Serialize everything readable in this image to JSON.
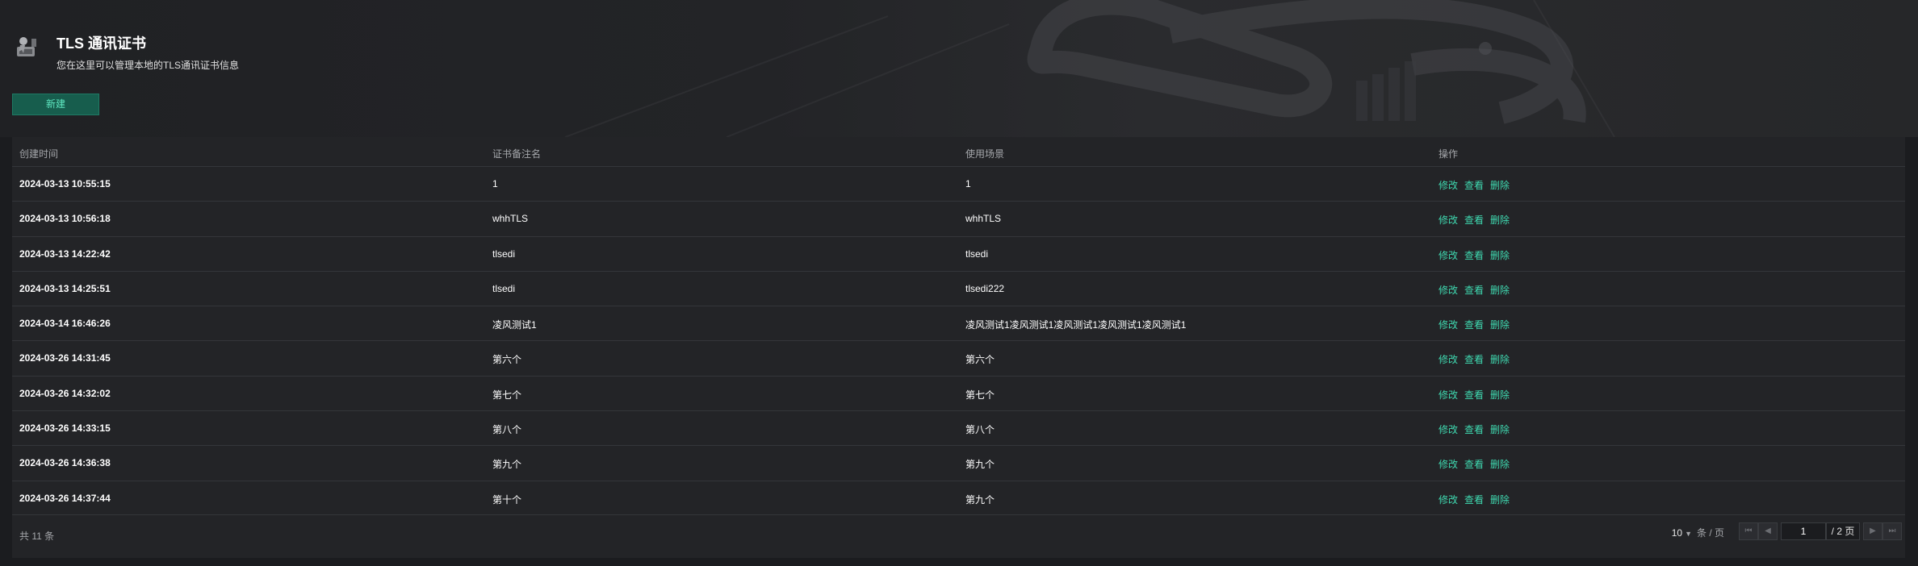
{
  "header": {
    "title": "TLS 通讯证书",
    "subtitle": "您在这里可以管理本地的TLS通讯证书信息",
    "new_label": "新建"
  },
  "table": {
    "columns": [
      "创建时间",
      "证书备注名",
      "使用场景",
      "操作"
    ],
    "actions": [
      "修改",
      "查看",
      "删除"
    ],
    "rows": [
      {
        "created": "2024-03-13 10:55:15",
        "name": "1",
        "scene": "1"
      },
      {
        "created": "2024-03-13 10:56:18",
        "name": "whhTLS",
        "scene": "whhTLS"
      },
      {
        "created": "2024-03-13 14:22:42",
        "name": "tlsedi",
        "scene": "tlsedi"
      },
      {
        "created": "2024-03-13 14:25:51",
        "name": "tlsedi",
        "scene": "tlsedi222"
      },
      {
        "created": "2024-03-14 16:46:26",
        "name": "凌风测试1",
        "scene": "凌风测试1凌风测试1凌风测试1凌风测试1凌风测试1"
      },
      {
        "created": "2024-03-26 14:31:45",
        "name": "第六个",
        "scene": "第六个"
      },
      {
        "created": "2024-03-26 14:32:02",
        "name": "第七个",
        "scene": "第七个"
      },
      {
        "created": "2024-03-26 14:33:15",
        "name": "第八个",
        "scene": "第八个"
      },
      {
        "created": "2024-03-26 14:36:38",
        "name": "第九个",
        "scene": "第九个"
      },
      {
        "created": "2024-03-26 14:37:44",
        "name": "第十个",
        "scene": "第九个"
      }
    ]
  },
  "pagination": {
    "total_text": "共 11 条",
    "page_size": "10",
    "page_size_unit": "条 / 页",
    "current_page": "1",
    "total_pages": "/ 2 页",
    "first_icon": "first-page-icon",
    "prev_icon": "prev-page-icon",
    "next_icon": "next-page-icon",
    "last_icon": "last-page-icon"
  },
  "colors": {
    "accent": "#3fd9b0",
    "button_bg": "#175d4d",
    "background": "#1b1c1f",
    "panel": "#232427"
  }
}
